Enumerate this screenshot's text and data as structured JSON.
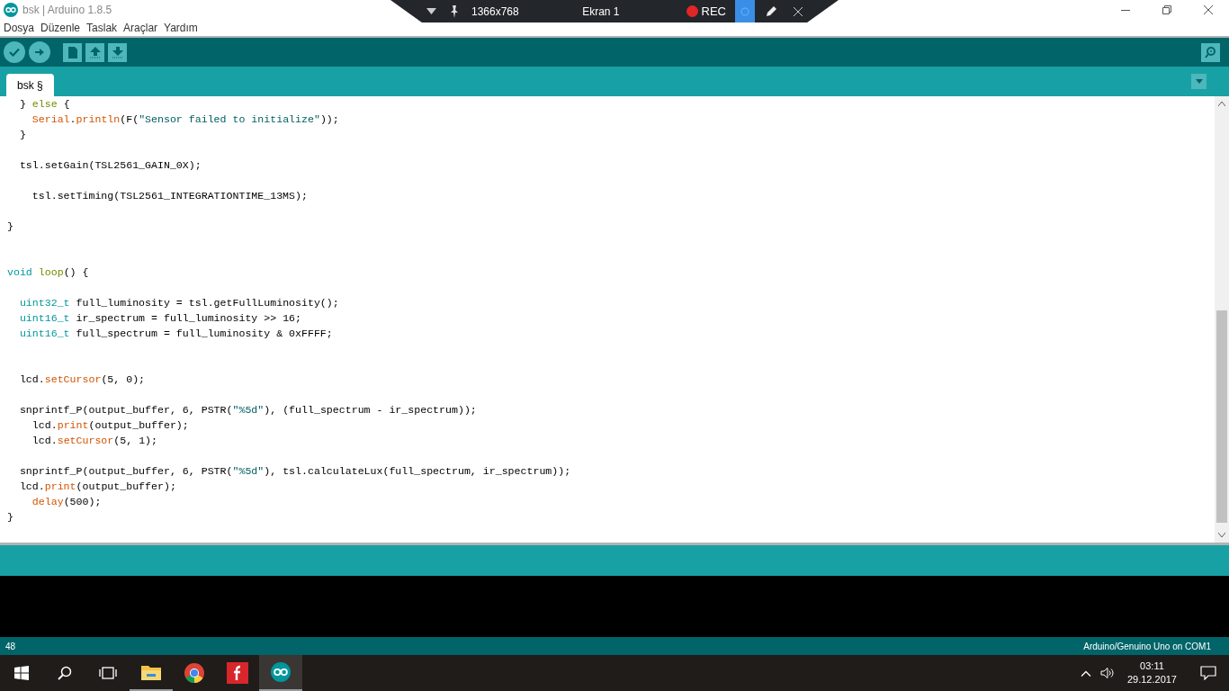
{
  "window": {
    "title": "bsk | Arduino 1.8.5"
  },
  "recorder_bar": {
    "resolution": "1366x768",
    "screen": "Ekran 1",
    "rec": "REC"
  },
  "menu": [
    "Dosya",
    "Düzenle",
    "Taslak",
    "Araçlar",
    "Yardım"
  ],
  "tabs": [
    {
      "label": "bsk §",
      "selected": true
    }
  ],
  "editor": {
    "lines": [
      {
        "kind": "code",
        "tokens": [
          {
            "kind": "plain",
            "text": "  } "
          },
          {
            "kind": "keyword",
            "text": "else"
          },
          {
            "kind": "plain",
            "text": " {"
          }
        ]
      },
      {
        "kind": "code",
        "tokens": [
          {
            "kind": "function",
            "text": "    Serial"
          },
          {
            "kind": "plain",
            "text": "."
          },
          {
            "kind": "function",
            "text": "println"
          },
          {
            "kind": "plain",
            "text": "(F("
          },
          {
            "kind": "string",
            "text": "\"Sensor failed to initialize\""
          },
          {
            "kind": "plain",
            "text": "));"
          }
        ]
      },
      {
        "kind": "code",
        "tokens": [
          {
            "kind": "plain",
            "text": "  }"
          }
        ]
      },
      {
        "kind": "blank"
      },
      {
        "kind": "code",
        "tokens": [
          {
            "kind": "plain",
            "text": "  tsl.setGain(TSL2561_GAIN_0X);"
          }
        ]
      },
      {
        "kind": "blank"
      },
      {
        "kind": "code",
        "tokens": [
          {
            "kind": "plain",
            "text": "    tsl.setTiming(TSL2561_INTEGRATIONTIME_13MS);"
          }
        ]
      },
      {
        "kind": "blank"
      },
      {
        "kind": "code",
        "tokens": [
          {
            "kind": "plain",
            "text": "}"
          }
        ]
      },
      {
        "kind": "blank"
      },
      {
        "kind": "blank"
      },
      {
        "kind": "code",
        "tokens": [
          {
            "kind": "type",
            "text": "void"
          },
          {
            "kind": "keyword",
            "text": " loop"
          },
          {
            "kind": "plain",
            "text": "() {"
          }
        ]
      },
      {
        "kind": "blank"
      },
      {
        "kind": "code",
        "tokens": [
          {
            "kind": "type",
            "text": "  uint32_t"
          },
          {
            "kind": "plain",
            "text": " full_luminosity = tsl.getFullLuminosity();"
          }
        ]
      },
      {
        "kind": "code",
        "tokens": [
          {
            "kind": "type",
            "text": "  uint16_t"
          },
          {
            "kind": "plain",
            "text": " ir_spectrum = full_luminosity >> 16;"
          }
        ]
      },
      {
        "kind": "code",
        "tokens": [
          {
            "kind": "type",
            "text": "  uint16_t"
          },
          {
            "kind": "plain",
            "text": " full_spectrum = full_luminosity & 0xFFFF;"
          }
        ]
      },
      {
        "kind": "blank"
      },
      {
        "kind": "blank"
      },
      {
        "kind": "code",
        "tokens": [
          {
            "kind": "plain",
            "text": "  lcd."
          },
          {
            "kind": "function",
            "text": "setCursor"
          },
          {
            "kind": "plain",
            "text": "(5, 0);"
          }
        ]
      },
      {
        "kind": "blank"
      },
      {
        "kind": "code",
        "tokens": [
          {
            "kind": "plain",
            "text": "  snprintf_P(output_buffer, 6, PSTR("
          },
          {
            "kind": "string",
            "text": "\"%5d\""
          },
          {
            "kind": "plain",
            "text": "), (full_spectrum - ir_spectrum));"
          }
        ]
      },
      {
        "kind": "code",
        "tokens": [
          {
            "kind": "plain",
            "text": "    lcd."
          },
          {
            "kind": "function",
            "text": "print"
          },
          {
            "kind": "plain",
            "text": "(output_buffer);"
          }
        ]
      },
      {
        "kind": "code",
        "tokens": [
          {
            "kind": "plain",
            "text": "    lcd."
          },
          {
            "kind": "function",
            "text": "setCursor"
          },
          {
            "kind": "plain",
            "text": "(5, 1);"
          }
        ]
      },
      {
        "kind": "blank"
      },
      {
        "kind": "code",
        "tokens": [
          {
            "kind": "plain",
            "text": "  snprintf_P(output_buffer, 6, PSTR("
          },
          {
            "kind": "string",
            "text": "\"%5d\""
          },
          {
            "kind": "plain",
            "text": "), tsl.calculateLux(full_spectrum, ir_spectrum));"
          }
        ]
      },
      {
        "kind": "code",
        "tokens": [
          {
            "kind": "plain",
            "text": "  lcd."
          },
          {
            "kind": "function",
            "text": "print"
          },
          {
            "kind": "plain",
            "text": "(output_buffer);"
          }
        ]
      },
      {
        "kind": "code",
        "tokens": [
          {
            "kind": "function",
            "text": "    delay"
          },
          {
            "kind": "plain",
            "text": "(500);"
          }
        ]
      },
      {
        "kind": "code",
        "tokens": [
          {
            "kind": "plain",
            "text": "}"
          }
        ]
      }
    ]
  },
  "status_bar": {
    "line": "48",
    "board": "Arduino/Genuino Uno on COM1"
  },
  "taskbar": {
    "time": "03:11",
    "date": "29.12.2017"
  }
}
